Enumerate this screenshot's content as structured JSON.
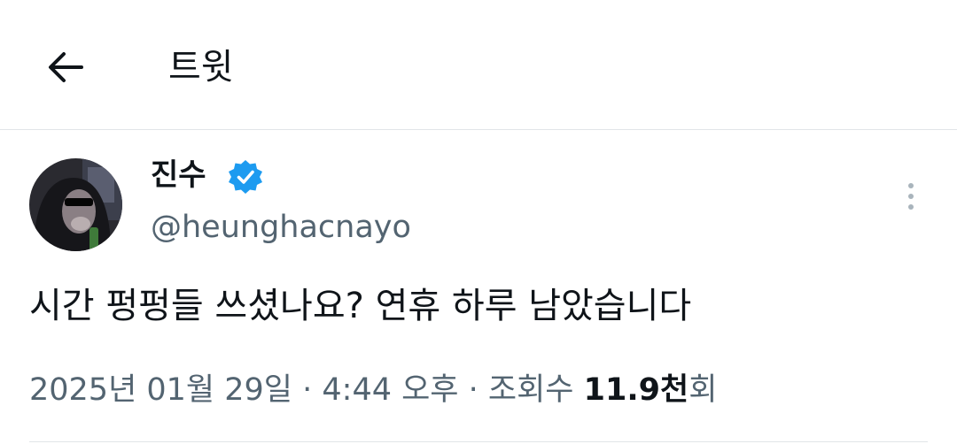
{
  "header": {
    "title": "트윗",
    "back_icon": "arrow-left-icon"
  },
  "tweet": {
    "author_name": "진수",
    "author_handle": "@heunghacnayo",
    "verified_icon": "verified-badge-icon",
    "verified_color": "#1d9bf0",
    "more_icon": "more-vertical-icon",
    "text": "시간 펑펑들 쓰셨나요? 연휴 하루 남았습니다",
    "date": "2025년 01월 29일",
    "separator1": " · ",
    "time": "4:44 오후",
    "separator2": " · ",
    "views_label": "조회수 ",
    "views_value": "11.9천",
    "views_suffix": "회"
  }
}
